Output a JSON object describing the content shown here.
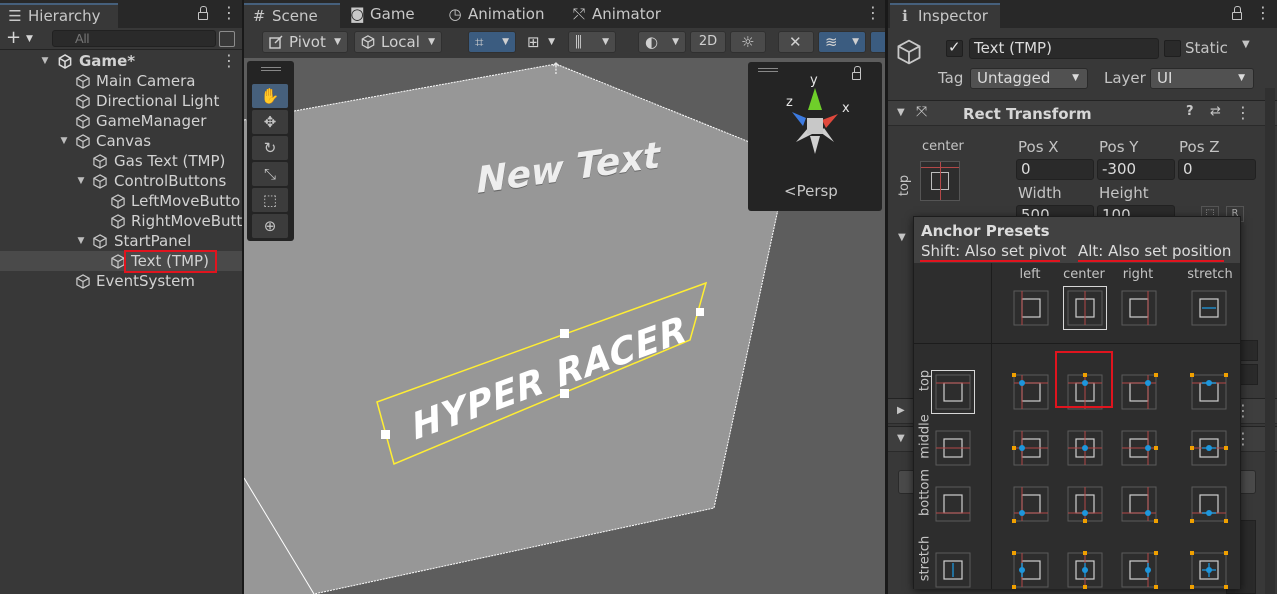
{
  "hierarchy": {
    "tab_label": "Hierarchy",
    "search_placeholder": "All",
    "items": [
      {
        "label": "Game*"
      },
      {
        "label": "Main Camera"
      },
      {
        "label": "Directional Light"
      },
      {
        "label": "GameManager"
      },
      {
        "label": "Canvas"
      },
      {
        "label": "Gas Text (TMP)"
      },
      {
        "label": "ControlButtons"
      },
      {
        "label": "LeftMoveButto"
      },
      {
        "label": "RightMoveButt"
      },
      {
        "label": "StartPanel"
      },
      {
        "label": "Text (TMP)"
      },
      {
        "label": "EventSystem"
      }
    ]
  },
  "scene_window": {
    "tabs": [
      {
        "label": "Scene",
        "icon": "grid-icon"
      },
      {
        "label": "Game",
        "icon": "gamepad-icon"
      },
      {
        "label": "Animation",
        "icon": "clock-icon"
      },
      {
        "label": "Animator",
        "icon": "animator-icon"
      }
    ],
    "toolbar": {
      "pivot_label": "Pivot",
      "local_label": "Local",
      "mode_2d_label": "2D"
    },
    "viewport": {
      "new_text": "New Text",
      "hyper_racer_text": "HYPER RACER",
      "persp_label": "Persp",
      "axis_labels": {
        "x": "x",
        "y": "y",
        "z": "z"
      }
    }
  },
  "inspector": {
    "tab_label": "Inspector",
    "object_name": "Text (TMP)",
    "active": true,
    "static_label": "Static",
    "tag_label": "Tag",
    "tag_value": "Untagged",
    "layer_label": "Layer",
    "layer_value": "UI",
    "rect_transform": {
      "title": "Rect Transform",
      "anchor_h": "center",
      "anchor_v": "top",
      "pos_x_label": "Pos X",
      "pos_x": "0",
      "pos_y_label": "Pos Y",
      "pos_y": "-300",
      "pos_z_label": "Pos Z",
      "pos_z": "0",
      "width_label": "Width",
      "width": "500",
      "height_label": "Height",
      "height": "100"
    },
    "anchor_presets": {
      "title": "Anchor Presets",
      "shift_note": "Shift: Also set pivot",
      "alt_note": "Alt: Also set position",
      "columns": [
        "left",
        "center",
        "right",
        "stretch"
      ],
      "rows": [
        "top",
        "middle",
        "bottom",
        "stretch"
      ],
      "selected": "top-center"
    }
  },
  "colors": {
    "selection_red": "#e0141e",
    "accent_blue": "#46607c",
    "anchor_orange": "#f0a000",
    "pivot_blue": "#1e96dc"
  }
}
